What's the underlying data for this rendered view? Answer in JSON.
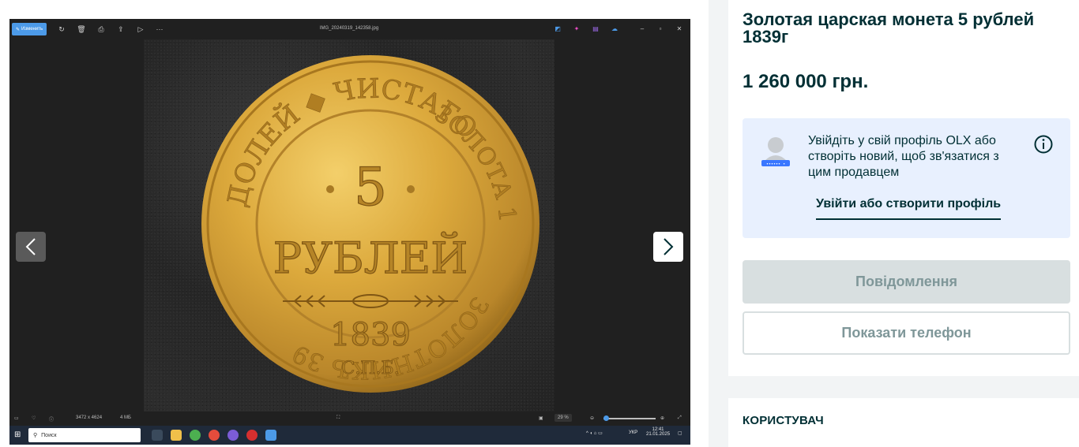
{
  "viewer": {
    "edit_label": "Изменить",
    "filename": "IMG_20240319_142358.jpg",
    "status_dimensions": "3472 x 4624",
    "status_size": "4 МБ",
    "zoom": "29 %",
    "taskbar_search": "Поиск",
    "tray_lang": "УКР",
    "tray_time": "12:41",
    "tray_date": "21.01.2025"
  },
  "coin": {
    "top_text": "ДОЛЕЙ ◆ ЧИСТАГО",
    "value": "5",
    "denomination": "РУБЛЕЙ",
    "year": "1839",
    "mint": "С.П.Б.",
    "bottom_text": "ЗОЛОТНИКЪ 39",
    "right_text": "ЗОЛОТА 1"
  },
  "listing": {
    "title": "Золотая царская монета 5 рублей 1839г",
    "price": "1 260 000 грн."
  },
  "login_box": {
    "text": "Увійдіть у свій профіль OLX або створіть новий, щоб зв'язатися з цим продавцем",
    "link": "Увійти або створити профіль"
  },
  "buttons": {
    "message": "Повідомлення",
    "show_phone": "Показати телефон"
  },
  "user_section": {
    "heading": "КОРИСТУВАЧ"
  },
  "colors": {
    "brand_dark": "#002f34",
    "login_bg": "#e8f0fe",
    "disabled_btn": "#d8dfe0",
    "viewer_bg": "#202020",
    "taskbar_bg": "#1f2a3a",
    "gold": "#d9a635"
  }
}
